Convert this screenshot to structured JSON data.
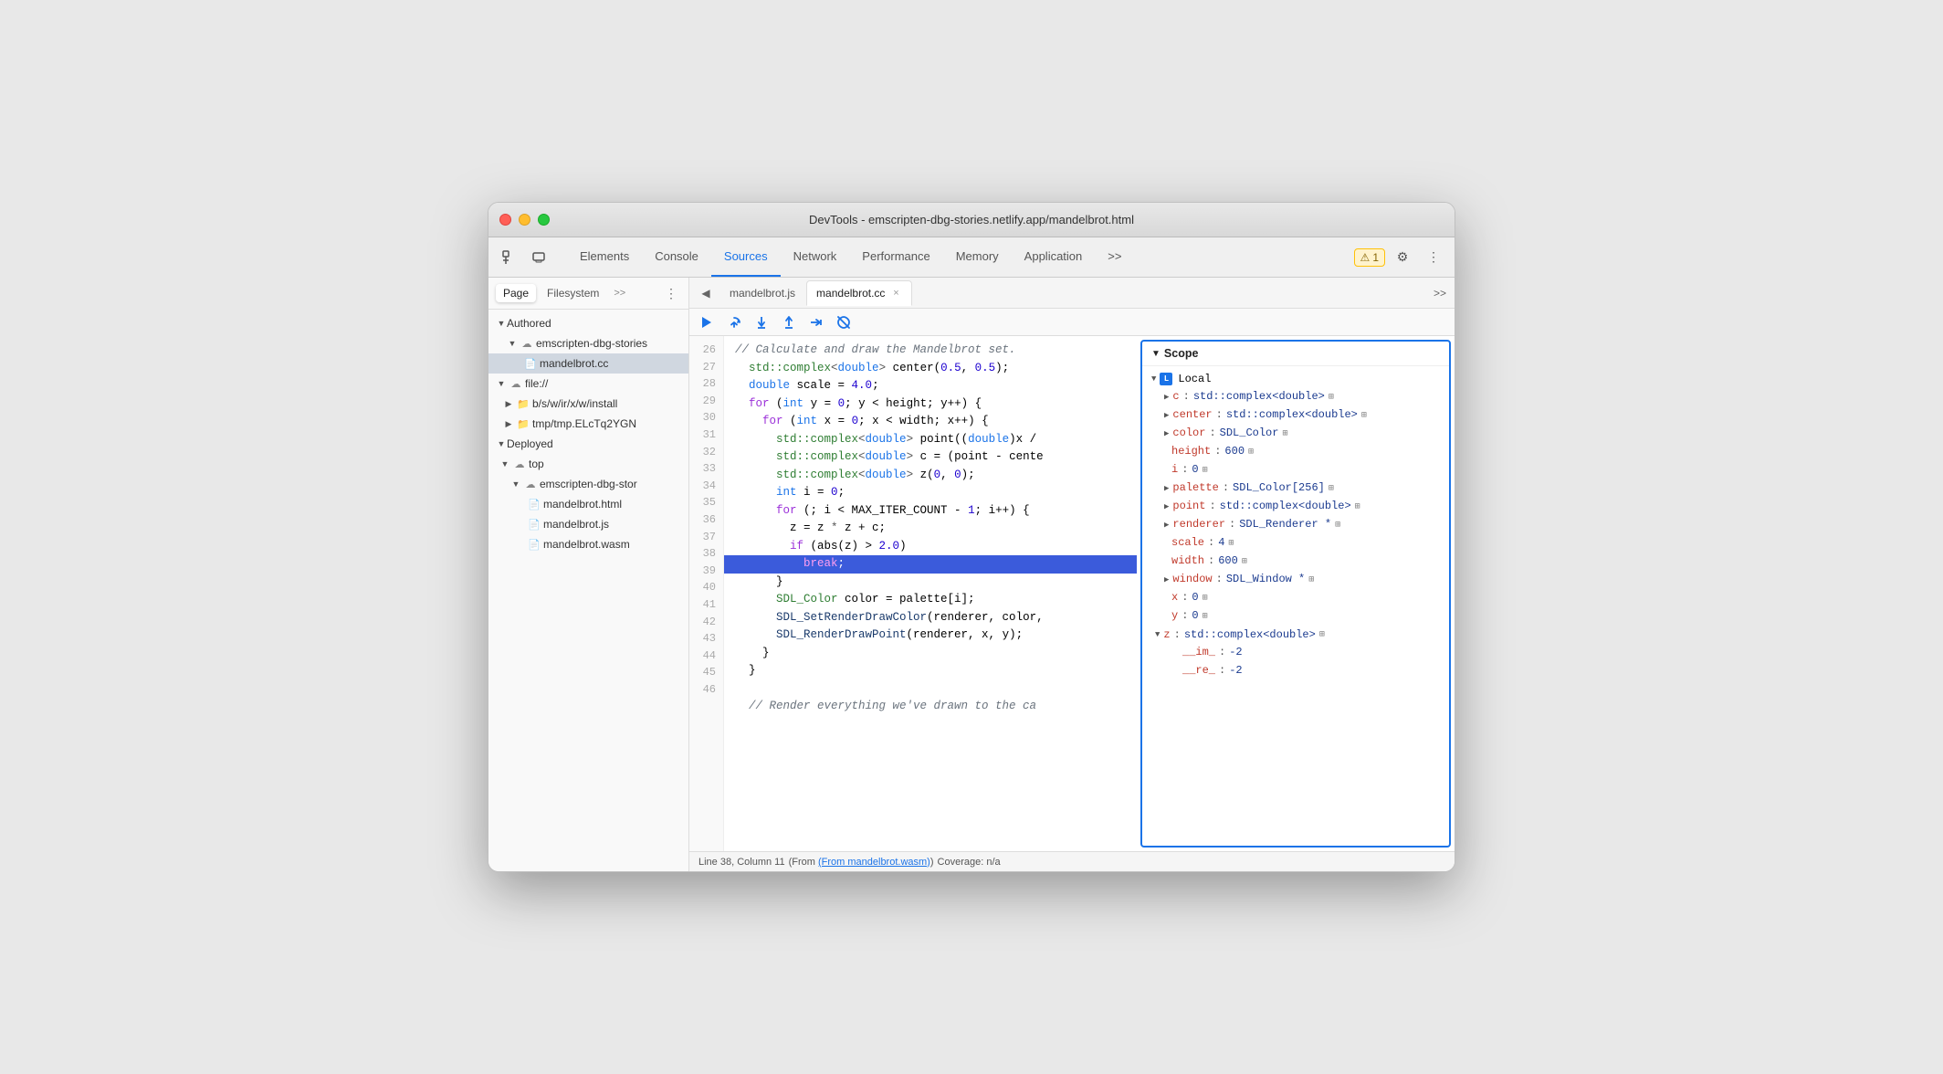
{
  "window": {
    "title": "DevTools - emscripten-dbg-stories.netlify.app/mandelbrot.html"
  },
  "toolbar": {
    "tabs": [
      {
        "id": "elements",
        "label": "Elements",
        "active": false
      },
      {
        "id": "console",
        "label": "Console",
        "active": false
      },
      {
        "id": "sources",
        "label": "Sources",
        "active": true
      },
      {
        "id": "network",
        "label": "Network",
        "active": false
      },
      {
        "id": "performance",
        "label": "Performance",
        "active": false
      },
      {
        "id": "memory",
        "label": "Memory",
        "active": false
      },
      {
        "id": "application",
        "label": "Application",
        "active": false
      }
    ],
    "warning_count": "1",
    "more_label": ">>"
  },
  "sidebar": {
    "tabs": [
      {
        "label": "Page",
        "active": true
      },
      {
        "label": "Filesystem",
        "active": false
      }
    ],
    "tree": {
      "authored_label": "Authored",
      "emscripten_cloud": "emscripten-dbg-stories",
      "mandelbrot_cc": "mandelbrot.cc",
      "file_label": "file://",
      "bswirx": "b/s/w/ir/x/w/install",
      "tmp": "tmp/tmp.ELcTq2YGN",
      "deployed_label": "Deployed",
      "top_label": "top",
      "emscripten_cloud2": "emscripten-dbg-stor",
      "mandelbrot_html": "mandelbrot.html",
      "mandelbrot_js": "mandelbrot.js",
      "mandelbrot_wasm": "mandelbrot.wasm"
    }
  },
  "editor": {
    "tabs": [
      {
        "label": "mandelbrot.js",
        "active": false,
        "closeable": false
      },
      {
        "label": "mandelbrot.cc",
        "active": true,
        "closeable": true
      }
    ],
    "lines": [
      {
        "num": 26,
        "content": "// Calculate and draw the Mandelbrot set.",
        "type": "comment"
      },
      {
        "num": 27,
        "content": "  std::complex<double> center(0.5, 0.5);",
        "type": "code"
      },
      {
        "num": 28,
        "content": "  double scale = 4.0;",
        "type": "code"
      },
      {
        "num": 29,
        "content": "  for (int y = 0; y < height; y++) {",
        "type": "code"
      },
      {
        "num": 30,
        "content": "    for (int x = 0; x < width; x++) {",
        "type": "code"
      },
      {
        "num": 31,
        "content": "      std::complex<double> point((double)x /",
        "type": "code"
      },
      {
        "num": 32,
        "content": "      std::complex<double> c = (point - cente",
        "type": "code"
      },
      {
        "num": 33,
        "content": "      std::complex<double> z(0, 0);",
        "type": "code"
      },
      {
        "num": 34,
        "content": "      int i = 0;",
        "type": "code"
      },
      {
        "num": 35,
        "content": "      for (; i < MAX_ITER_COUNT - 1; i++) {",
        "type": "code"
      },
      {
        "num": 36,
        "content": "        z = z * z + c;",
        "type": "code"
      },
      {
        "num": 37,
        "content": "        if (abs(z) > 2.0)",
        "type": "code"
      },
      {
        "num": 38,
        "content": "          break;",
        "type": "highlighted"
      },
      {
        "num": 39,
        "content": "      }",
        "type": "code"
      },
      {
        "num": 40,
        "content": "      SDL_Color color = palette[i];",
        "type": "code"
      },
      {
        "num": 41,
        "content": "      SDL_SetRenderDrawColor(renderer, color,",
        "type": "code"
      },
      {
        "num": 42,
        "content": "      SDL_RenderDrawPoint(renderer, x, y);",
        "type": "code"
      },
      {
        "num": 43,
        "content": "    }",
        "type": "code"
      },
      {
        "num": 44,
        "content": "  }",
        "type": "code"
      },
      {
        "num": 45,
        "content": "",
        "type": "code"
      },
      {
        "num": 46,
        "content": "  // Render everything we've drawn to the ca",
        "type": "comment"
      }
    ],
    "status": "Line 38, Column 11",
    "status_from": "(From mandelbrot.wasm)",
    "status_coverage": "Coverage: n/a"
  },
  "scope": {
    "title": "Scope",
    "section_local": "Local",
    "items": [
      {
        "key": "c",
        "value": "std::complex<double>",
        "expandable": true,
        "mem": true
      },
      {
        "key": "center",
        "value": "std::complex<double>",
        "expandable": true,
        "mem": true
      },
      {
        "key": "color",
        "value": "SDL_Color",
        "expandable": true,
        "mem": true
      },
      {
        "key": "height",
        "value": "600",
        "expandable": false,
        "mem": true
      },
      {
        "key": "i",
        "value": "0",
        "expandable": false,
        "mem": true
      },
      {
        "key": "palette",
        "value": "SDL_Color[256]",
        "expandable": true,
        "mem": true
      },
      {
        "key": "point",
        "value": "std::complex<double>",
        "expandable": true,
        "mem": true
      },
      {
        "key": "renderer",
        "value": "SDL_Renderer *",
        "expandable": true,
        "mem": true
      },
      {
        "key": "scale",
        "value": "4",
        "expandable": false,
        "mem": true
      },
      {
        "key": "width",
        "value": "600",
        "expandable": false,
        "mem": true
      },
      {
        "key": "window",
        "value": "SDL_Window *",
        "expandable": true,
        "mem": true
      },
      {
        "key": "x",
        "value": "0",
        "expandable": false,
        "mem": true
      },
      {
        "key": "y",
        "value": "0",
        "expandable": false,
        "mem": true
      },
      {
        "key": "z",
        "value": "std::complex<double>",
        "expandable": true,
        "mem": true,
        "expanded": true
      },
      {
        "key": "__im_",
        "value": "-2",
        "expandable": false,
        "mem": false,
        "child": true
      },
      {
        "key": "__re_",
        "value": "-2",
        "expandable": false,
        "mem": false,
        "child": true
      }
    ]
  },
  "debug_controls": {
    "resume": "▶",
    "step_over": "↩",
    "step_into": "↓",
    "step_out": "↑",
    "step": "→",
    "deactivate": "⊗"
  }
}
